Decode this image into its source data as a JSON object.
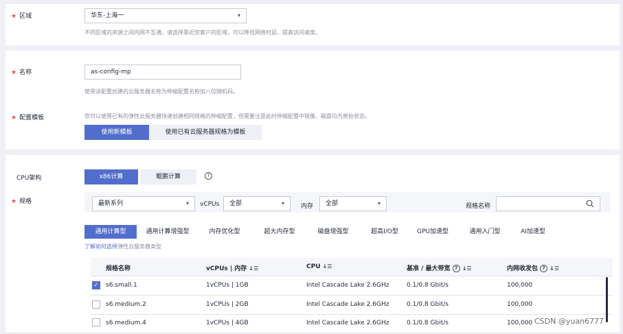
{
  "region": {
    "label": "区域",
    "value": "华东-上海一",
    "hint": "不同区域的资源之间内网不互通。请选择靠近您客户的区域，可以降低网络时延、提高访问速度。"
  },
  "name": {
    "label": "名称",
    "value": "as-config-mp",
    "hint": "使用该配置创建的云服务器名称为伸缩配置名称加八位随机码。"
  },
  "template": {
    "label": "配置模板",
    "hint": "您可以使用已有的弹性云服务器快速创建相同规格的伸缩配置，但需要注意此时伸缩配置中镜像、磁盘均为原始状态。",
    "new_btn": "使用新模板",
    "existing_btn": "使用已有云服务器规格为模板"
  },
  "cpu_arch": {
    "label": "CPU架构",
    "x86": "x86计算",
    "kunpeng": "鲲鹏计算",
    "help": "?"
  },
  "spec": {
    "label": "规格",
    "series_value": "最新系列",
    "vcpus_label": "vCPUs",
    "vcpus_value": "全部",
    "mem_label": "内存",
    "mem_value": "全部",
    "name_label": "规格名称",
    "name_placeholder": "",
    "tabs": [
      "通用计算型",
      "通用计算增强型",
      "内存优化型",
      "超大内存型",
      "磁盘增强型",
      "超高I/O型",
      "GPU加速型",
      "通用入门型",
      "AI加速型"
    ],
    "learn_link": "了解如何选择",
    "learn_rest": "弹性云服务器类型"
  },
  "table": {
    "headers": [
      "规格名称",
      "vCPUs | 内存",
      "CPU",
      "基准 / 最大带宽",
      "内网收发包"
    ],
    "rows": [
      {
        "name": "s6.small.1",
        "vcpu_mem": "1vCPUs | 1GB",
        "cpu": "Intel Cascade Lake 2.6GHz",
        "bw": "0.1/0.8 Gbit/s",
        "pps": "100,000",
        "checked": true
      },
      {
        "name": "s6.medium.2",
        "vcpu_mem": "1vCPUs | 2GB",
        "cpu": "Intel Cascade Lake 2.6GHz",
        "bw": "0.1/0.8 Gbit/s",
        "pps": "100,000",
        "checked": false
      },
      {
        "name": "s6.medium.4",
        "vcpu_mem": "1vCPUs | 4GB",
        "cpu": "Intel Cascade Lake 2.6GHz",
        "bw": "0.1/0.8 Gbit/s",
        "pps": "100,000",
        "checked": false
      }
    ]
  },
  "watermark": "CSDN @yuan6777",
  "icons": {
    "caret": "▾",
    "search": "search-icon",
    "check": "✓",
    "sort": "↓☰"
  }
}
